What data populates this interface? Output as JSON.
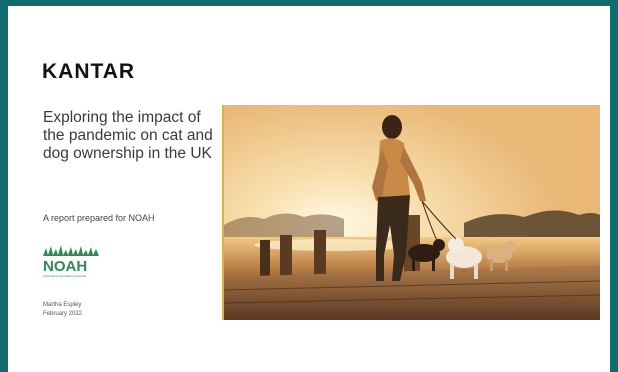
{
  "slide": {
    "logo_text": "KANTAR",
    "title": "Exploring the impact of the pandemic on cat and dog ownership in the UK",
    "subtitle": "A report prepared for NOAH",
    "partner_logo": {
      "text": "NOAH",
      "tagline": "Supporting the health of animals",
      "color": "#2e8b57"
    },
    "author": "Martha Espley",
    "date": "February 2022",
    "photo": {
      "icon": "woman-walking-dogs-on-pier-photo"
    }
  },
  "colors": {
    "border": "#0e6b6e",
    "accent_line": "#d8b247",
    "noah_green": "#2e8b57"
  }
}
